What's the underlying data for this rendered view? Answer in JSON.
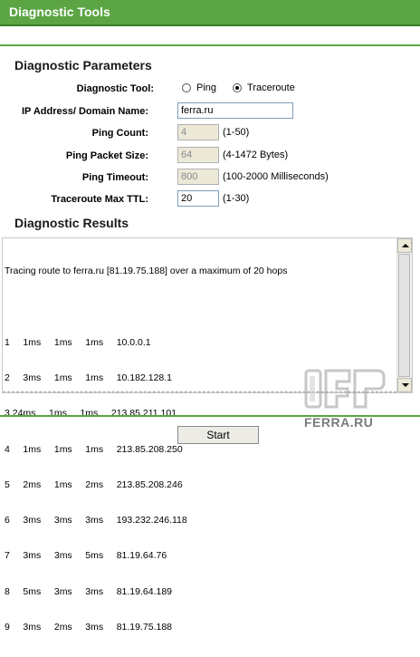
{
  "header": {
    "title": "Diagnostic Tools"
  },
  "params": {
    "heading": "Diagnostic Parameters",
    "tool_label": "Diagnostic Tool:",
    "tool_options": [
      "Ping",
      "Traceroute"
    ],
    "tool_selected": "Traceroute",
    "ip_label": "IP Address/ Domain Name:",
    "ip_value": "ferra.ru",
    "ping_count_label": "Ping Count:",
    "ping_count_value": "4",
    "ping_count_hint": "(1-50)",
    "packet_size_label": "Ping Packet Size:",
    "packet_size_value": "64",
    "packet_size_hint": "(4-1472 Bytes)",
    "timeout_label": "Ping Timeout:",
    "timeout_value": "800",
    "timeout_hint": "(100-2000 Milliseconds)",
    "ttl_label": "Traceroute Max TTL:",
    "ttl_value": "20",
    "ttl_hint": "(1-30)"
  },
  "results": {
    "heading": "Diagnostic Results",
    "lines": [
      "Tracing route to ferra.ru [81.19.75.188] over a maximum of 20 hops",
      "",
      "1     1ms     1ms     1ms     10.0.0.1",
      "2     3ms     1ms     1ms     10.182.128.1",
      "3 24ms     1ms     1ms     213.85.211.101",
      "4     1ms     1ms     1ms     213.85.208.250",
      "5     2ms     1ms     2ms     213.85.208.246",
      "6     3ms     3ms     3ms     193.232.246.118",
      "7     3ms     3ms     5ms     81.19.64.76",
      "8     5ms     3ms     3ms     81.19.64.189",
      "9     3ms     2ms     3ms     81.19.75.188"
    ]
  },
  "actions": {
    "start_label": "Start"
  },
  "watermark": {
    "text": "FERRA.RU"
  },
  "colors": {
    "header_green": "#5ca545"
  }
}
